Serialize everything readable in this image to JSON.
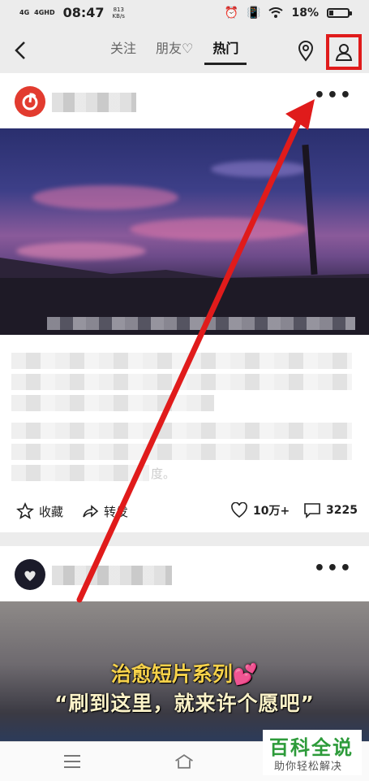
{
  "status_bar": {
    "signal_1": "4G",
    "signal_2": "4GHD",
    "time": "08:47",
    "speed_value": "813",
    "speed_unit": "KB/s",
    "battery": "18%"
  },
  "nav": {
    "tabs": [
      {
        "label": "关注"
      },
      {
        "label": "朋友♡"
      },
      {
        "label": "热门"
      }
    ],
    "active_tab": "热门"
  },
  "post1": {
    "text_tail": "度。",
    "actions": {
      "favorite": "收藏",
      "share": "转发",
      "likes": "10万+",
      "comments": "3225"
    }
  },
  "post2": {
    "video_line1": "治愈短片系列💕",
    "video_line2": "“刷到这里，就来许个愿吧”"
  },
  "watermark": {
    "title": "百科全说",
    "subtitle": "助你轻松解决"
  },
  "colors": {
    "highlight_red": "#e01b1b",
    "watermark_green": "#2d9b3a"
  }
}
